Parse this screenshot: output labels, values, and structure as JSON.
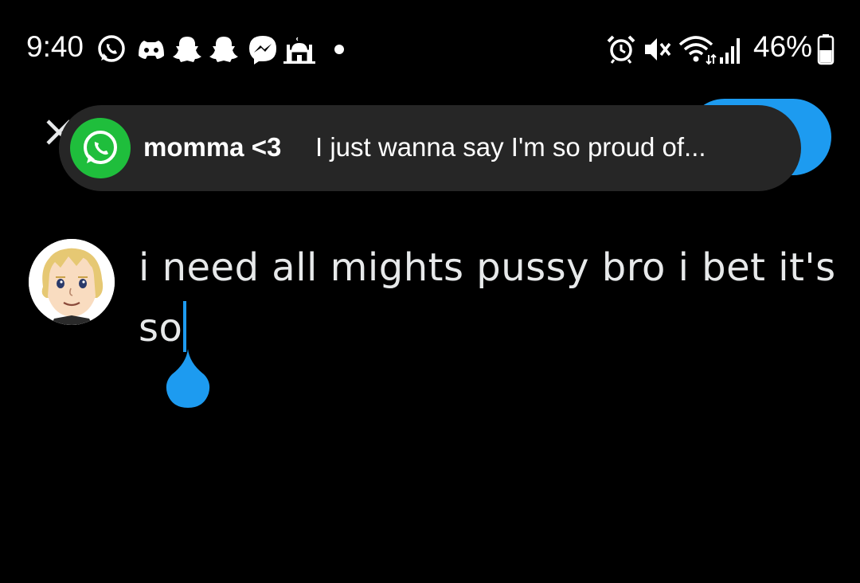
{
  "status_bar": {
    "time": "9:40",
    "battery": "46%",
    "left_icons": [
      "whatsapp-icon",
      "discord-icon",
      "snapchat-icon",
      "snapchat-icon",
      "messenger-icon",
      "mosque-icon",
      "dot-icon"
    ],
    "right_icons": [
      "alarm-icon",
      "mute-icon",
      "wifi-icon",
      "signal-icon",
      "battery-icon"
    ]
  },
  "notification": {
    "app_icon": "whatsapp-icon",
    "sender": "momma <3",
    "message": "I just wanna say I'm so proud of..."
  },
  "compose": {
    "text": "i need all mights pussy bro i bet it's so"
  },
  "colors": {
    "accent": "#1d9bf0",
    "whatsapp": "#1fbe3c",
    "notification_bg": "#262626",
    "background": "#000000",
    "text": "#e7e9ea"
  }
}
